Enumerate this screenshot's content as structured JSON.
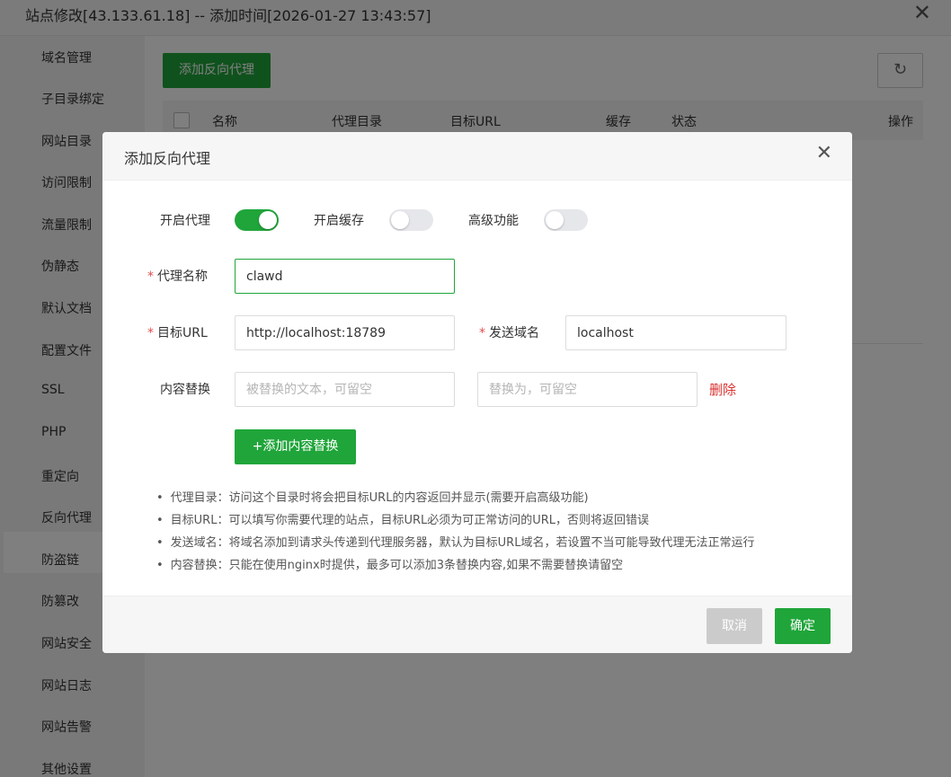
{
  "window": {
    "title": "站点修改[43.133.61.18] -- 添加时间[2026-01-27 13:43:57]",
    "close_glyph": "✕"
  },
  "sidebar": {
    "items": [
      {
        "label": "域名管理"
      },
      {
        "label": "子目录绑定"
      },
      {
        "label": "网站目录"
      },
      {
        "label": "访问限制"
      },
      {
        "label": "流量限制"
      },
      {
        "label": "伪静态"
      },
      {
        "label": "默认文档"
      },
      {
        "label": "配置文件"
      },
      {
        "label": "SSL"
      },
      {
        "label": "PHP"
      },
      {
        "label": "重定向"
      },
      {
        "label": "反向代理"
      },
      {
        "label": "防盗链"
      },
      {
        "label": "防篡改"
      },
      {
        "label": "网站安全"
      },
      {
        "label": "网站日志"
      },
      {
        "label": "网站告警"
      },
      {
        "label": "其他设置"
      }
    ],
    "active": "反向代理"
  },
  "page": {
    "add_button": "添加反向代理",
    "refresh_glyph": "↻",
    "table_headers": {
      "name": "名称",
      "proxy_dir": "代理目录",
      "target_url": "目标URL",
      "cache": "缓存",
      "status": "状态",
      "actions": "操作"
    }
  },
  "modal": {
    "title": "添加反向代理",
    "close_glyph": "✕",
    "toggles": {
      "proxy": {
        "label": "开启代理",
        "on": true
      },
      "cache": {
        "label": "开启缓存",
        "on": false
      },
      "advanced": {
        "label": "高级功能",
        "on": false
      }
    },
    "fields": {
      "required_mark": "*",
      "proxy_name": {
        "label": "代理名称",
        "value": "clawd"
      },
      "target_url": {
        "label": "目标URL",
        "value": "http://localhost:18789"
      },
      "send_domain": {
        "label": "发送域名",
        "value": "localhost"
      },
      "content_replace": {
        "label": "内容替换",
        "from_placeholder": "被替换的文本，可留空",
        "to_placeholder": "替换为，可留空",
        "delete_label": "删除"
      }
    },
    "add_replace_button": "+添加内容替换",
    "tips": [
      "代理目录：访问这个目录时将会把目标URL的内容返回并显示(需要开启高级功能)",
      "目标URL：可以填写你需要代理的站点，目标URL必须为可正常访问的URL，否则将返回错误",
      "发送域名：将域名添加到请求头传递到代理服务器，默认为目标URL域名，若设置不当可能导致代理无法正常运行",
      "内容替换：只能在使用nginx时提供，最多可以添加3条替换内容,如果不需要替换请留空"
    ],
    "cancel_button": "取消",
    "confirm_button": "确定"
  },
  "colors": {
    "primary": "#20a53a",
    "danger": "#d9322f",
    "required": "#e24d4d",
    "cancel": "#cbcbcb"
  }
}
